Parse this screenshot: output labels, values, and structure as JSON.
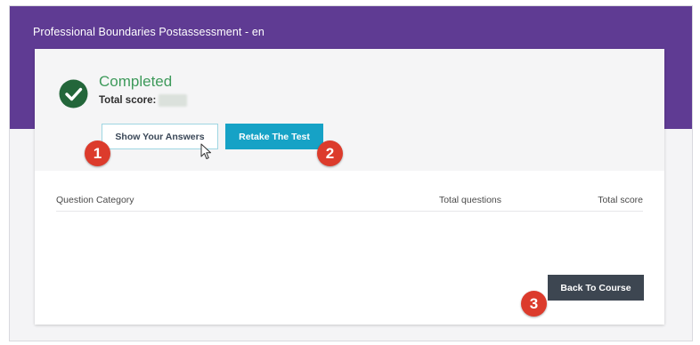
{
  "header": {
    "title": "Professional Boundaries Postassessment - en"
  },
  "result": {
    "status": "Completed",
    "score_label": "Total score:",
    "status_color": "#3e9a5b",
    "check_icon": "check-circle-icon"
  },
  "actions": {
    "show_answers_label": "Show Your Answers",
    "retake_label": "Retake The Test",
    "back_label": "Back To Course"
  },
  "table": {
    "columns": [
      "Question Category",
      "Total questions",
      "Total score"
    ],
    "rows": []
  },
  "badges": [
    "1",
    "2",
    "3"
  ],
  "colors": {
    "header_band": "#5f3b93",
    "retake_button": "#16a2c6",
    "back_button": "#3d4651",
    "badge": "#dc3b2c"
  }
}
